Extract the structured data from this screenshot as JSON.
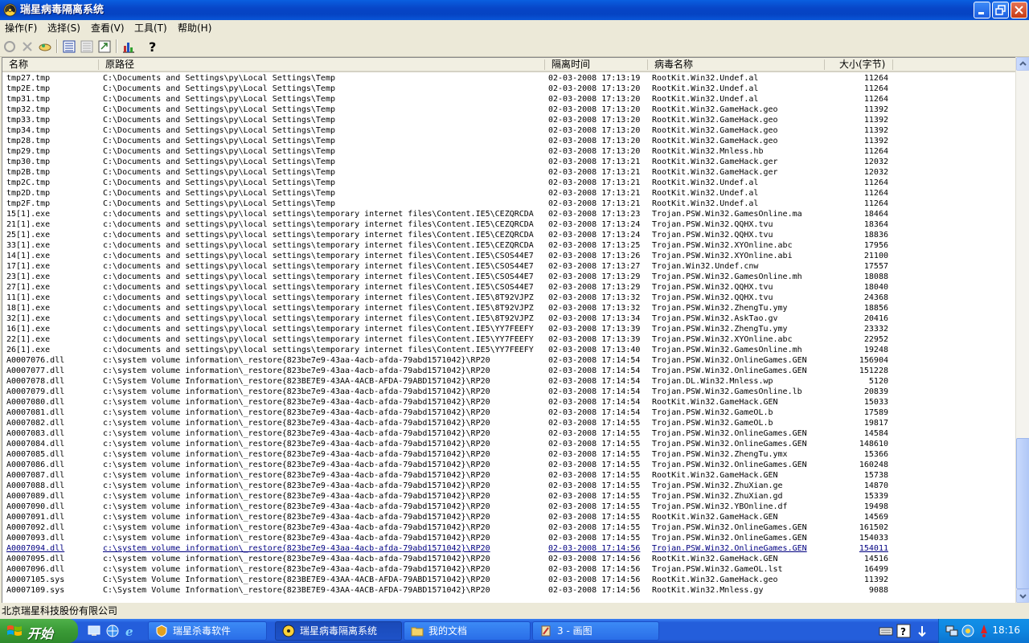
{
  "window": {
    "title": "瑞星病毒隔离系统"
  },
  "menu": [
    "操作(F)",
    "选择(S)",
    "查看(V)",
    "工具(T)",
    "帮助(H)"
  ],
  "columns": {
    "name": "名称",
    "path": "原路径",
    "time": "隔离时间",
    "virus": "病毒名称",
    "size": "大小(字节)"
  },
  "rows": [
    {
      "name": "tmp27.tmp",
      "path": "C:\\Documents and Settings\\py\\Local Settings\\Temp",
      "time": "02-03-2008 17:13:19",
      "virus": "RootKit.Win32.Undef.al",
      "size": "11264"
    },
    {
      "name": "tmp2E.tmp",
      "path": "C:\\Documents and Settings\\py\\Local Settings\\Temp",
      "time": "02-03-2008 17:13:20",
      "virus": "RootKit.Win32.Undef.al",
      "size": "11264"
    },
    {
      "name": "tmp31.tmp",
      "path": "C:\\Documents and Settings\\py\\Local Settings\\Temp",
      "time": "02-03-2008 17:13:20",
      "virus": "RootKit.Win32.Undef.al",
      "size": "11264"
    },
    {
      "name": "tmp32.tmp",
      "path": "C:\\Documents and Settings\\py\\Local Settings\\Temp",
      "time": "02-03-2008 17:13:20",
      "virus": "RootKit.Win32.GameHack.geo",
      "size": "11392"
    },
    {
      "name": "tmp33.tmp",
      "path": "C:\\Documents and Settings\\py\\Local Settings\\Temp",
      "time": "02-03-2008 17:13:20",
      "virus": "RootKit.Win32.GameHack.geo",
      "size": "11392"
    },
    {
      "name": "tmp34.tmp",
      "path": "C:\\Documents and Settings\\py\\Local Settings\\Temp",
      "time": "02-03-2008 17:13:20",
      "virus": "RootKit.Win32.GameHack.geo",
      "size": "11392"
    },
    {
      "name": "tmp28.tmp",
      "path": "C:\\Documents and Settings\\py\\Local Settings\\Temp",
      "time": "02-03-2008 17:13:20",
      "virus": "RootKit.Win32.GameHack.geo",
      "size": "11392"
    },
    {
      "name": "tmp29.tmp",
      "path": "C:\\Documents and Settings\\py\\Local Settings\\Temp",
      "time": "02-03-2008 17:13:20",
      "virus": "RootKit.Win32.Mnless.hb",
      "size": "11264"
    },
    {
      "name": "tmp30.tmp",
      "path": "C:\\Documents and Settings\\py\\Local Settings\\Temp",
      "time": "02-03-2008 17:13:21",
      "virus": "RootKit.Win32.GameHack.ger",
      "size": "12032"
    },
    {
      "name": "tmp2B.tmp",
      "path": "C:\\Documents and Settings\\py\\Local Settings\\Temp",
      "time": "02-03-2008 17:13:21",
      "virus": "RootKit.Win32.GameHack.ger",
      "size": "12032"
    },
    {
      "name": "tmp2C.tmp",
      "path": "C:\\Documents and Settings\\py\\Local Settings\\Temp",
      "time": "02-03-2008 17:13:21",
      "virus": "RootKit.Win32.Undef.al",
      "size": "11264"
    },
    {
      "name": "tmp2D.tmp",
      "path": "C:\\Documents and Settings\\py\\Local Settings\\Temp",
      "time": "02-03-2008 17:13:21",
      "virus": "RootKit.Win32.Undef.al",
      "size": "11264"
    },
    {
      "name": "tmp2F.tmp",
      "path": "C:\\Documents and Settings\\py\\Local Settings\\Temp",
      "time": "02-03-2008 17:13:21",
      "virus": "RootKit.Win32.Undef.al",
      "size": "11264"
    },
    {
      "name": "15[1].exe",
      "path": "c:\\documents and settings\\py\\local settings\\temporary internet files\\Content.IE5\\CEZQRCDA",
      "time": "02-03-2008 17:13:23",
      "virus": "Trojan.PSW.Win32.GamesOnline.ma",
      "size": "18464"
    },
    {
      "name": "21[1].exe",
      "path": "c:\\documents and settings\\py\\local settings\\temporary internet files\\Content.IE5\\CEZQRCDA",
      "time": "02-03-2008 17:13:24",
      "virus": "Trojan.PSW.Win32.QQHX.tvu",
      "size": "18364"
    },
    {
      "name": "25[1].exe",
      "path": "c:\\documents and settings\\py\\local settings\\temporary internet files\\Content.IE5\\CEZQRCDA",
      "time": "02-03-2008 17:13:24",
      "virus": "Trojan.PSW.Win32.QQHX.tvu",
      "size": "18836"
    },
    {
      "name": "33[1].exe",
      "path": "c:\\documents and settings\\py\\local settings\\temporary internet files\\Content.IE5\\CEZQRCDA",
      "time": "02-03-2008 17:13:25",
      "virus": "Trojan.PSW.Win32.XYOnline.abc",
      "size": "17956"
    },
    {
      "name": "14[1].exe",
      "path": "c:\\documents and settings\\py\\local settings\\temporary internet files\\Content.IE5\\CSOS44E7",
      "time": "02-03-2008 17:13:26",
      "virus": "Trojan.PSW.Win32.XYOnline.abi",
      "size": "21100"
    },
    {
      "name": "17[1].exe",
      "path": "c:\\documents and settings\\py\\local settings\\temporary internet files\\Content.IE5\\CSOS44E7",
      "time": "02-03-2008 17:13:27",
      "virus": "Trojan.Win32.Undef.cnw",
      "size": "17557"
    },
    {
      "name": "23[1].exe",
      "path": "c:\\documents and settings\\py\\local settings\\temporary internet files\\Content.IE5\\CSOS44E7",
      "time": "02-03-2008 17:13:29",
      "virus": "Trojan.PSW.Win32.GamesOnline.mh",
      "size": "18088"
    },
    {
      "name": "27[1].exe",
      "path": "c:\\documents and settings\\py\\local settings\\temporary internet files\\Content.IE5\\CSOS44E7",
      "time": "02-03-2008 17:13:29",
      "virus": "Trojan.PSW.Win32.QQHX.tvu",
      "size": "18040"
    },
    {
      "name": "11[1].exe",
      "path": "c:\\documents and settings\\py\\local settings\\temporary internet files\\Content.IE5\\8T92VJPZ",
      "time": "02-03-2008 17:13:32",
      "virus": "Trojan.PSW.Win32.QQHX.tvu",
      "size": "24368"
    },
    {
      "name": "18[1].exe",
      "path": "c:\\documents and settings\\py\\local settings\\temporary internet files\\Content.IE5\\8T92VJPZ",
      "time": "02-03-2008 17:13:32",
      "virus": "Trojan.PSW.Win32.ZhengTu.ymy",
      "size": "18856"
    },
    {
      "name": "32[1].exe",
      "path": "c:\\documents and settings\\py\\local settings\\temporary internet files\\Content.IE5\\8T92VJPZ",
      "time": "02-03-2008 17:13:34",
      "virus": "Trojan.PSW.Win32.AskTao.gv",
      "size": "20416"
    },
    {
      "name": "16[1].exe",
      "path": "c:\\documents and settings\\py\\local settings\\temporary internet files\\Content.IE5\\YY7FEEFY",
      "time": "02-03-2008 17:13:39",
      "virus": "Trojan.PSW.Win32.ZhengTu.ymy",
      "size": "23332"
    },
    {
      "name": "22[1].exe",
      "path": "c:\\documents and settings\\py\\local settings\\temporary internet files\\Content.IE5\\YY7FEEFY",
      "time": "02-03-2008 17:13:39",
      "virus": "Trojan.PSW.Win32.XYOnline.abc",
      "size": "22952"
    },
    {
      "name": "26[1].exe",
      "path": "c:\\documents and settings\\py\\local settings\\temporary internet files\\Content.IE5\\YY7FEEFY",
      "time": "02-03-2008 17:13:40",
      "virus": "Trojan.PSW.Win32.GamesOnline.mh",
      "size": "19248"
    },
    {
      "name": "A0007076.dll",
      "path": "c:\\system volume information\\_restore{823be7e9-43aa-4acb-afda-79abd1571042}\\RP20",
      "time": "02-03-2008 17:14:54",
      "virus": "Trojan.PSW.Win32.OnlineGames.GEN",
      "size": "156904"
    },
    {
      "name": "A0007077.dll",
      "path": "c:\\system volume information\\_restore{823be7e9-43aa-4acb-afda-79abd1571042}\\RP20",
      "time": "02-03-2008 17:14:54",
      "virus": "Trojan.PSW.Win32.OnlineGames.GEN",
      "size": "151228"
    },
    {
      "name": "A0007078.dll",
      "path": "C:\\System Volume Information\\_restore{823BE7E9-43AA-4ACB-AFDA-79ABD1571042}\\RP20",
      "time": "02-03-2008 17:14:54",
      "virus": "Trojan.DL.Win32.Mnless.wp",
      "size": "5120"
    },
    {
      "name": "A0007079.dll",
      "path": "c:\\system volume information\\_restore{823be7e9-43aa-4acb-afda-79abd1571042}\\RP20",
      "time": "02-03-2008 17:14:54",
      "virus": "Trojan.PSW.Win32.GamesOnline.lb",
      "size": "20839"
    },
    {
      "name": "A0007080.dll",
      "path": "c:\\system volume information\\_restore{823be7e9-43aa-4acb-afda-79abd1571042}\\RP20",
      "time": "02-03-2008 17:14:54",
      "virus": "RootKit.Win32.GameHack.GEN",
      "size": "15033"
    },
    {
      "name": "A0007081.dll",
      "path": "c:\\system volume information\\_restore{823be7e9-43aa-4acb-afda-79abd1571042}\\RP20",
      "time": "02-03-2008 17:14:54",
      "virus": "Trojan.PSW.Win32.GameOL.b",
      "size": "17589"
    },
    {
      "name": "A0007082.dll",
      "path": "c:\\system volume information\\_restore{823be7e9-43aa-4acb-afda-79abd1571042}\\RP20",
      "time": "02-03-2008 17:14:55",
      "virus": "Trojan.PSW.Win32.GameOL.b",
      "size": "19817"
    },
    {
      "name": "A0007083.dll",
      "path": "c:\\system volume information\\_restore{823be7e9-43aa-4acb-afda-79abd1571042}\\RP20",
      "time": "02-03-2008 17:14:55",
      "virus": "Trojan.PSW.Win32.OnlineGames.GEN",
      "size": "14584"
    },
    {
      "name": "A0007084.dll",
      "path": "c:\\system volume information\\_restore{823be7e9-43aa-4acb-afda-79abd1571042}\\RP20",
      "time": "02-03-2008 17:14:55",
      "virus": "Trojan.PSW.Win32.OnlineGames.GEN",
      "size": "148610"
    },
    {
      "name": "A0007085.dll",
      "path": "c:\\system volume information\\_restore{823be7e9-43aa-4acb-afda-79abd1571042}\\RP20",
      "time": "02-03-2008 17:14:55",
      "virus": "Trojan.PSW.Win32.ZhengTu.ymx",
      "size": "15366"
    },
    {
      "name": "A0007086.dll",
      "path": "c:\\system volume information\\_restore{823be7e9-43aa-4acb-afda-79abd1571042}\\RP20",
      "time": "02-03-2008 17:14:55",
      "virus": "Trojan.PSW.Win32.OnlineGames.GEN",
      "size": "160248"
    },
    {
      "name": "A0007087.dll",
      "path": "c:\\system volume information\\_restore{823be7e9-43aa-4acb-afda-79abd1571042}\\RP20",
      "time": "02-03-2008 17:14:55",
      "virus": "RootKit.Win32.GameHack.GEN",
      "size": "15738"
    },
    {
      "name": "A0007088.dll",
      "path": "c:\\system volume information\\_restore{823be7e9-43aa-4acb-afda-79abd1571042}\\RP20",
      "time": "02-03-2008 17:14:55",
      "virus": "Trojan.PSW.Win32.ZhuXian.ge",
      "size": "14870"
    },
    {
      "name": "A0007089.dll",
      "path": "c:\\system volume information\\_restore{823be7e9-43aa-4acb-afda-79abd1571042}\\RP20",
      "time": "02-03-2008 17:14:55",
      "virus": "Trojan.PSW.Win32.ZhuXian.gd",
      "size": "15339"
    },
    {
      "name": "A0007090.dll",
      "path": "c:\\system volume information\\_restore{823be7e9-43aa-4acb-afda-79abd1571042}\\RP20",
      "time": "02-03-2008 17:14:55",
      "virus": "Trojan.PSW.Win32.YBOnline.df",
      "size": "19498"
    },
    {
      "name": "A0007091.dll",
      "path": "c:\\system volume information\\_restore{823be7e9-43aa-4acb-afda-79abd1571042}\\RP20",
      "time": "02-03-2008 17:14:55",
      "virus": "RootKit.Win32.GameHack.GEN",
      "size": "14569"
    },
    {
      "name": "A0007092.dll",
      "path": "c:\\system volume information\\_restore{823be7e9-43aa-4acb-afda-79abd1571042}\\RP20",
      "time": "02-03-2008 17:14:55",
      "virus": "Trojan.PSW.Win32.OnlineGames.GEN",
      "size": "161502"
    },
    {
      "name": "A0007093.dll",
      "path": "c:\\system volume information\\_restore{823be7e9-43aa-4acb-afda-79abd1571042}\\RP20",
      "time": "02-03-2008 17:14:55",
      "virus": "Trojan.PSW.Win32.OnlineGames.GEN",
      "size": "154033"
    },
    {
      "name": "A0007094.dll",
      "path": "c:\\system volume information\\_restore{823be7e9-43aa-4acb-afda-79abd1571042}\\RP20",
      "time": "02-03-2008 17:14:56",
      "virus": "Trojan.PSW.Win32.OnlineGames.GEN",
      "size": "154011",
      "hot": true
    },
    {
      "name": "A0007095.dll",
      "path": "c:\\system volume information\\_restore{823be7e9-43aa-4acb-afda-79abd1571042}\\RP20",
      "time": "02-03-2008 17:14:56",
      "virus": "RootKit.Win32.GameHack.GEN",
      "size": "14516"
    },
    {
      "name": "A0007096.dll",
      "path": "c:\\system volume information\\_restore{823be7e9-43aa-4acb-afda-79abd1571042}\\RP20",
      "time": "02-03-2008 17:14:56",
      "virus": "Trojan.PSW.Win32.GameOL.lst",
      "size": "16499"
    },
    {
      "name": "A0007105.sys",
      "path": "C:\\System Volume Information\\_restore{823BE7E9-43AA-4ACB-AFDA-79ABD1571042}\\RP20",
      "time": "02-03-2008 17:14:56",
      "virus": "RootKit.Win32.GameHack.geo",
      "size": "11392"
    },
    {
      "name": "A0007109.sys",
      "path": "C:\\System Volume Information\\_restore{823BE7E9-43AA-4ACB-AFDA-79ABD1571042}\\RP20",
      "time": "02-03-2008 17:14:56",
      "virus": "RootKit.Win32.Mnless.gy",
      "size": "9088"
    }
  ],
  "status": {
    "text": "北京瑞星科技股份有限公司"
  },
  "taskbar": {
    "start": "开始",
    "buttons": [
      "瑞星杀毒软件",
      "瑞星病毒隔离系统",
      "我的文档",
      "3 - 画图"
    ],
    "clock": "18:16"
  }
}
